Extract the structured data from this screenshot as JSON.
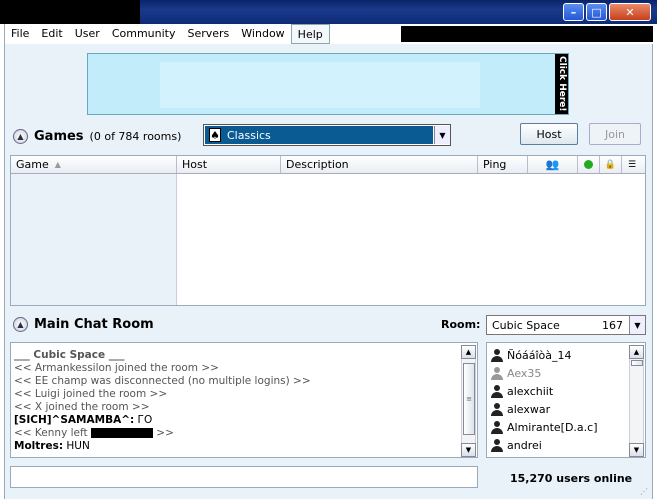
{
  "menu": [
    "File",
    "Edit",
    "User",
    "Community",
    "Servers",
    "Window",
    "Help"
  ],
  "ad": {
    "side_label": "Click Here!"
  },
  "games": {
    "title": "Games",
    "count_text": "(0 of 784 rooms)",
    "filter_value": "Classics",
    "host_button": "Host",
    "join_button": "Join",
    "columns": [
      "Game",
      "Host",
      "Description",
      "Ping"
    ]
  },
  "chat": {
    "title": "Main Chat Room",
    "room_label": "Room:",
    "room_name": "Cubic Space",
    "room_count": "167",
    "lines": [
      "___ Cubic Space ___",
      "<< Armankessilon joined the room >>",
      "<< EE champ was disconnected (no multiple logins) >>",
      "<< Luigi joined the room >>",
      "<< X joined the room >>"
    ],
    "msg1": {
      "nick": "[SICH]^SAMAMBA^:",
      "text": " ГО"
    },
    "kenny_prefix": "<< Kenny left ",
    "kenny_suffix": " >>",
    "msg2": {
      "nick": "Moltres:",
      "text": " HUN"
    }
  },
  "users": [
    {
      "name": "Ñóááîòà_14",
      "away": false
    },
    {
      "name": "Aex35",
      "away": true
    },
    {
      "name": "alexchiit",
      "away": false
    },
    {
      "name": "alexwar",
      "away": false
    },
    {
      "name": "Almirante[D.a.c]",
      "away": false
    },
    {
      "name": "andrei",
      "away": false
    }
  ],
  "online_text": "15,270 users online",
  "colors": {
    "accent": "#0a5a93",
    "panel": "#e9f2f8",
    "online_dot": "#22aa22"
  }
}
